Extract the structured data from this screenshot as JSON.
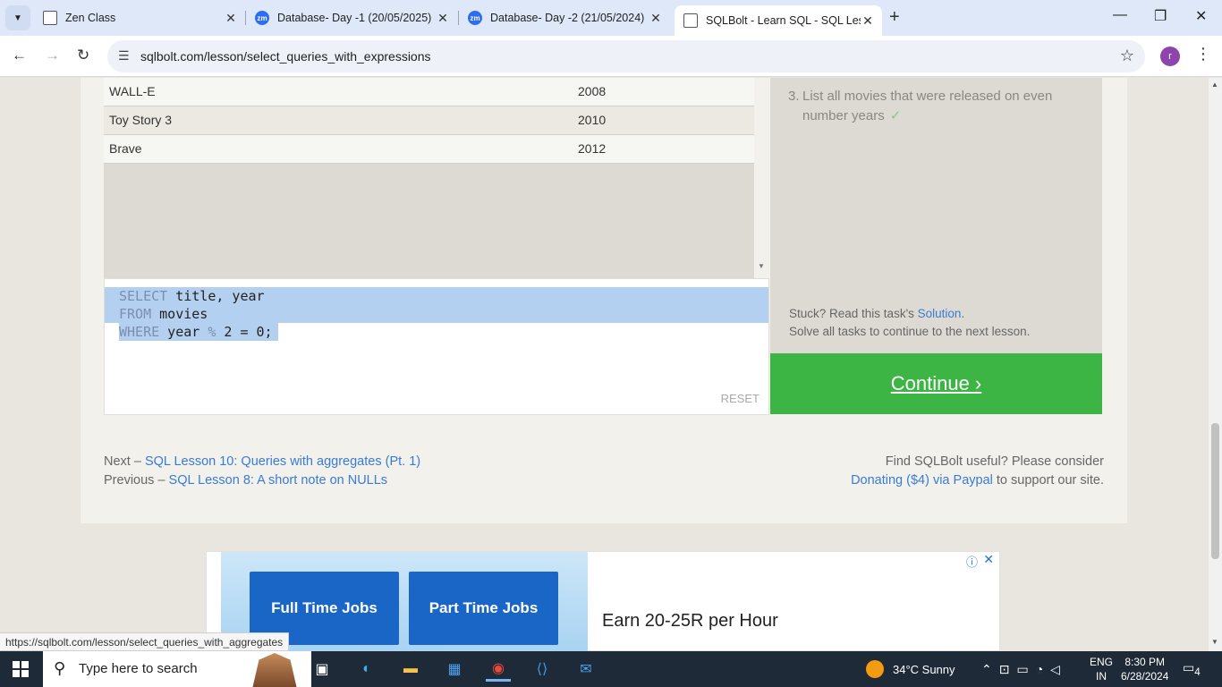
{
  "browser": {
    "tabs": [
      {
        "label": "Zen Class",
        "icon": "zen-class-icon"
      },
      {
        "label": "Database- Day -1 (20/05/2025)",
        "icon": "zoom-icon"
      },
      {
        "label": "Database- Day -2 (21/05/2024)",
        "icon": "zoom-icon"
      },
      {
        "label": "SQLBolt - Learn SQL - SQL Less",
        "icon": "sqlbolt-icon",
        "active": true
      }
    ],
    "url": "sqlbolt.com/lesson/select_queries_with_expressions",
    "profile_initial": "r"
  },
  "results": {
    "rows": [
      {
        "title": "WALL-E",
        "year": "2008"
      },
      {
        "title": "Toy Story 3",
        "year": "2010"
      },
      {
        "title": "Brave",
        "year": "2012"
      }
    ]
  },
  "editor": {
    "lines": [
      {
        "kw": "SELECT",
        "rest": " title, year"
      },
      {
        "kw": "FROM",
        "rest": " movies"
      },
      {
        "kw": "WHERE",
        "rest": " year ",
        "op": "%",
        "rest2": " 2 = 0;"
      }
    ],
    "reset_label": "RESET"
  },
  "task": {
    "number": "3.",
    "text": "List all movies that were released on even number years",
    "check": "✓",
    "stuck_prefix": "Stuck? Read this task's ",
    "solution_label": "Solution",
    "stuck_suffix": ".",
    "solve_all": "Solve all tasks to continue to the next lesson."
  },
  "continue_label": "Continue ›",
  "navigation": {
    "next_prefix": "Next – ",
    "next_label": "SQL Lesson 10: Queries with aggregates (Pt. 1)",
    "prev_prefix": "Previous – ",
    "prev_label": "SQL Lesson 8: A short note on NULLs"
  },
  "support": {
    "line1": "Find SQLBolt useful? Please consider",
    "donate_label": "Donating ($4) via Paypal",
    "line2_suffix": " to support our site."
  },
  "ad": {
    "button1": "Full Time Jobs",
    "button2": "Part Time Jobs",
    "headline": "Earn 20-25R per Hour"
  },
  "status_url": "https://sqlbolt.com/lesson/select_queries_with_aggregates",
  "taskbar": {
    "search_placeholder": "Type here to search",
    "weather": "34°C  Sunny",
    "lang_line1": "ENG",
    "lang_line2": "IN",
    "time": "8:30 PM",
    "date": "6/28/2024",
    "notifications": "4"
  }
}
